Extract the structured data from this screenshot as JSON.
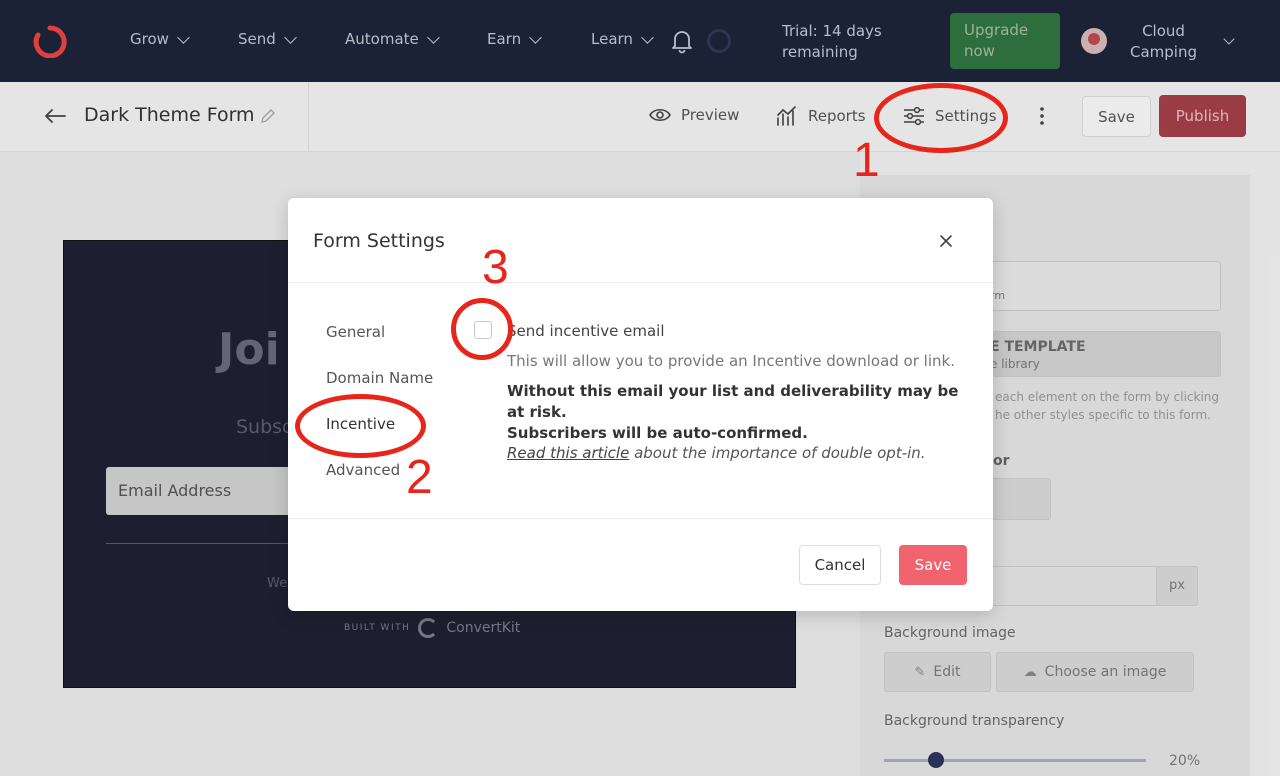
{
  "nav": {
    "items": [
      {
        "label": "Grow"
      },
      {
        "label": "Send"
      },
      {
        "label": "Automate"
      },
      {
        "label": "Earn"
      },
      {
        "label": "Learn"
      }
    ],
    "trial_line1": "Trial: 14 days",
    "trial_line2": "remaining",
    "upgrade_line1": "Upgrade",
    "upgrade_line2": "now",
    "account_line1": "Cloud",
    "account_line2": "Camping"
  },
  "subbar": {
    "title": "Dark Theme Form",
    "preview": "Preview",
    "reports": "Reports",
    "settings": "Settings",
    "save": "Save",
    "publish": "Publish"
  },
  "preview_form": {
    "heading": "Joi",
    "subheading": "Subsc",
    "email_placeholder": "Email Address",
    "footer_fragment": "We",
    "built_with": "BUILT WITH",
    "brand": "ConvertKit"
  },
  "right_panel": {
    "field_hint": "rm",
    "template_line1": "E TEMPLATE",
    "template_line2": "e library",
    "help_line1": "each element on the form by clicking",
    "help_line2": "he other styles specific to this form.",
    "color_label": "or",
    "unit": "px",
    "bg_image_label": "Background image",
    "edit": "Edit",
    "choose_image": "Choose an image",
    "bg_transparency_label": "Background transparency",
    "transparency_value": "20%",
    "transparency_fraction": 0.2
  },
  "modal": {
    "title": "Form Settings",
    "sidebar": [
      {
        "label": "General"
      },
      {
        "label": "Domain Name"
      },
      {
        "label": "Incentive"
      },
      {
        "label": "Advanced"
      }
    ],
    "checkbox_label": "Send incentive email",
    "checkbox_checked": false,
    "description": "This will allow you to provide an Incentive download or link.",
    "warning_line1": "Without this email your list and deliverability may be at risk.",
    "warning_line2": "Subscribers will be auto-confirmed.",
    "article_link": "Read this article",
    "article_rest": " about the importance of double opt-in.",
    "cancel": "Cancel",
    "save": "Save"
  },
  "annotations": {
    "n1": "1",
    "n2": "2",
    "n3": "3",
    "color": "#e8251b"
  }
}
